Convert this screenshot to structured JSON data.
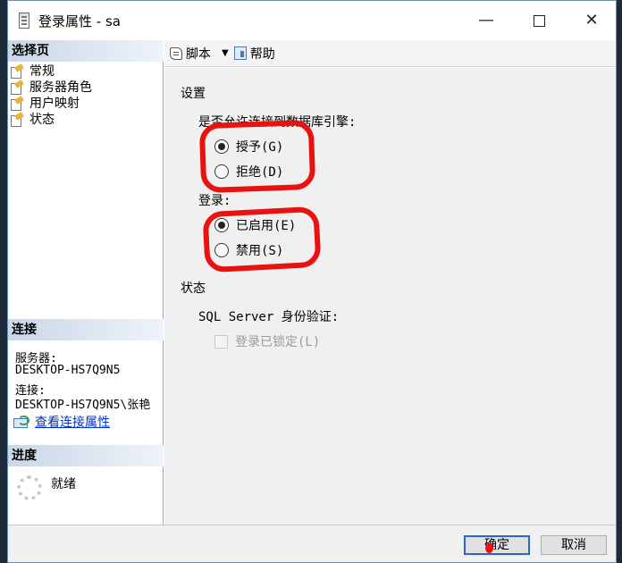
{
  "window": {
    "title": "登录属性 - sa",
    "minimize": "—",
    "maximize": "",
    "close": "✕"
  },
  "sidebar": {
    "select_page_header": "选择页",
    "items": [
      {
        "label": "常规"
      },
      {
        "label": "服务器角色"
      },
      {
        "label": "用户映射"
      },
      {
        "label": "状态"
      }
    ],
    "connection_header": "连接",
    "server_label": "服务器:",
    "server_value": "DESKTOP-HS7Q9N5",
    "connection_label": "连接:",
    "connection_value": "DESKTOP-HS7Q9N5\\张艳",
    "connection_link": "查看连接属性",
    "progress_header": "进度",
    "progress_status": "就绪"
  },
  "toolbar": {
    "script_label": "脚本",
    "dropdown": "▼",
    "help_label": "帮助"
  },
  "settings": {
    "title": "设置",
    "permission_label": "是否允许连接到数据库引擎:",
    "grant": {
      "label": "授予(G)",
      "checked": true
    },
    "deny": {
      "label": "拒绝(D)",
      "checked": false
    },
    "login_label": "登录:",
    "enabled": {
      "label": "已启用(E)",
      "checked": true
    },
    "disabled": {
      "label": "禁用(S)",
      "checked": false
    }
  },
  "status": {
    "title": "状态",
    "sql_auth_label": "SQL Server 身份验证:",
    "locked_label": "登录已锁定(L)",
    "locked_checked": false
  },
  "buttons": {
    "ok": "确定",
    "cancel": "取消"
  },
  "colors": {
    "annotation_red": "#ea1111",
    "link_blue": "#0033cc",
    "header_blue": "#c9d7e8"
  }
}
